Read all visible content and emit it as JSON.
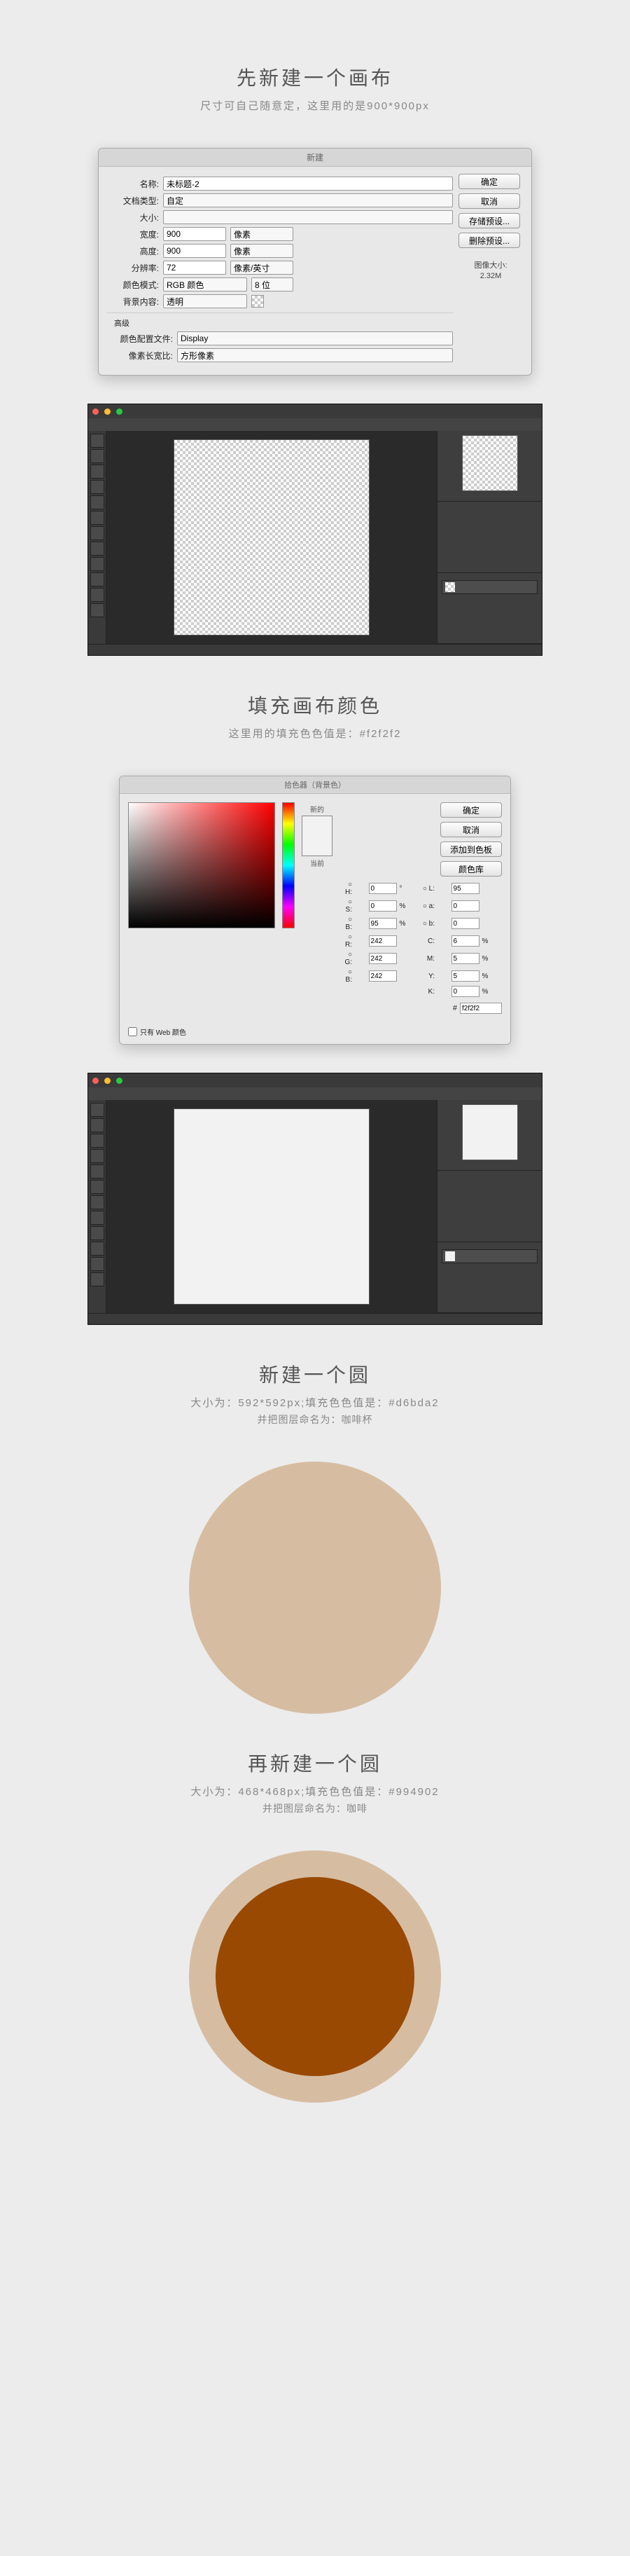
{
  "step1": {
    "title": "先新建一个画布",
    "sub": "尺寸可自己随意定，这里用的是900*900px"
  },
  "dialog_new": {
    "title": "新建",
    "name_label": "名称:",
    "name_value": "未标题-2",
    "doctype_label": "文档类型:",
    "doctype_value": "自定",
    "size_label": "大小:",
    "width_label": "宽度:",
    "width_value": "900",
    "height_label": "高度:",
    "height_value": "900",
    "unit_px": "像素",
    "res_label": "分辨率:",
    "res_value": "72",
    "res_unit": "像素/英寸",
    "mode_label": "颜色模式:",
    "mode_value": "RGB 颜色",
    "bit_value": "8 位",
    "bg_label": "背景内容:",
    "bg_value": "透明",
    "advanced": "高级",
    "profile_label": "颜色配置文件:",
    "profile_value": "Display",
    "aspect_label": "像素长宽比:",
    "aspect_value": "方形像素",
    "btn_ok": "确定",
    "btn_cancel": "取消",
    "btn_preset": "存储预设...",
    "btn_delpreset": "删除预设...",
    "imgsize_label": "图像大小:",
    "imgsize_value": "2.32M"
  },
  "step2": {
    "title": "填充画布颜色",
    "sub": "这里用的填充色色值是：#f2f2f2"
  },
  "dialog_color": {
    "title": "拾色器（背景色）",
    "newlabel": "新的",
    "curlabel": "当前",
    "btn_ok": "确定",
    "btn_cancel": "取消",
    "btn_addlib": "添加到色板",
    "btn_lib": "颜色库",
    "H": "0",
    "S": "0",
    "Bv": "95",
    "R": "242",
    "G": "242",
    "B": "242",
    "L": "95",
    "a": "0",
    "b": "0",
    "C": "6",
    "M": "5",
    "Y": "5",
    "K": "0",
    "hex": "f2f2f2",
    "webonly": "只有 Web 颜色"
  },
  "step3": {
    "title": "新建一个圆",
    "sub": "大小为：592*592px;填充色色值是：#d6bda2",
    "sub2": "并把图层命名为：咖啡杯"
  },
  "step4": {
    "title": "再新建一个圆",
    "sub": "大小为：468*468px;填充色色值是：#994902",
    "sub2": "并把图层命名为：咖啡"
  },
  "colors": {
    "bg": "#f2f2f2",
    "cup": "#d6bda2",
    "coffee": "#994902"
  }
}
